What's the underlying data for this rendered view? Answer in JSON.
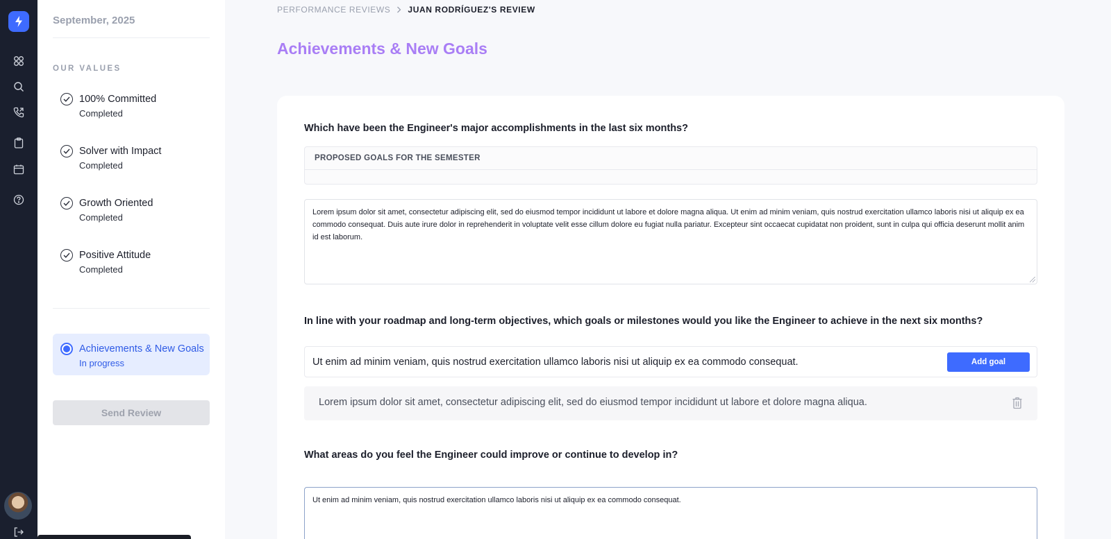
{
  "app": {
    "nav_icons": [
      "logo-bolt-icon",
      "grid-icon",
      "search-icon",
      "phone-icon",
      "clipboard-icon",
      "calendar-icon",
      "help-icon",
      "logout-icon"
    ]
  },
  "sidebar": {
    "date": "September, 2025",
    "values_heading": "OUR VALUES",
    "steps": [
      {
        "title": "100% Committed",
        "status": "Completed"
      },
      {
        "title": "Solver with Impact",
        "status": "Completed"
      },
      {
        "title": "Growth Oriented",
        "status": "Completed"
      },
      {
        "title": "Positive Attitude",
        "status": "Completed"
      }
    ],
    "active_step": {
      "title": "Achievements & New Goals",
      "status": "In progress"
    },
    "send_button": "Send Review"
  },
  "breadcrumb": {
    "parent": "PERFORMANCE REVIEWS",
    "current": "JUAN RODRÍGUEZ'S REVIEW"
  },
  "page": {
    "title": "Achievements & New Goals"
  },
  "form": {
    "q1": "Which have been the Engineer's major accomplishments in the last six months?",
    "goals_table_header": "PROPOSED GOALS FOR THE SEMESTER",
    "q1_answer": "Lorem ipsum dolor sit amet, consectetur adipiscing elit, sed do eiusmod tempor incididunt ut labore et dolore magna aliqua. Ut enim ad minim veniam, quis nostrud exercitation ullamco laboris nisi ut aliquip ex ea commodo consequat. Duis aute irure dolor in reprehenderit in voluptate velit esse cillum dolore eu fugiat nulla pariatur. Excepteur sint occaecat cupidatat non proident, sunt in culpa qui officia deserunt mollit anim id est laborum.",
    "q2": "In line with your roadmap and long-term objectives, which goals or milestones would you like the Engineer to achieve in the next six months?",
    "goal_input_value": "Ut enim ad minim veniam, quis nostrud exercitation ullamco laboris nisi ut aliquip ex ea commodo consequat.",
    "add_goal_button": "Add goal",
    "goals": [
      "Lorem ipsum dolor sit amet, consectetur adipiscing elit, sed do eiusmod tempor incididunt ut labore et dolore magna aliqua."
    ],
    "q3": "What areas do you feel the Engineer could improve or continue to develop in?",
    "q3_answer": "Ut enim ad minim veniam, quis nostrud exercitation ullamco laboris nisi ut aliquip ex ea commodo consequat."
  },
  "colors": {
    "accent": "#3e6bff",
    "title": "#a97ef5",
    "rail": "#1a1f2e"
  }
}
